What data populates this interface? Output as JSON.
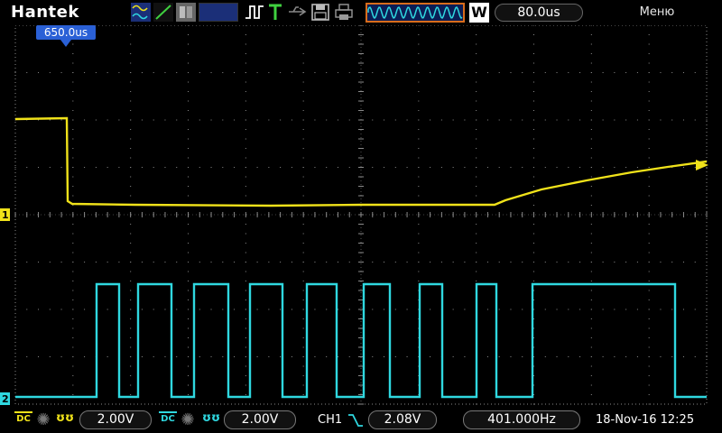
{
  "header": {
    "brand": "Hantek",
    "mode_w": "W",
    "timebase": "80.0us",
    "menu_label": "Меню"
  },
  "trigger_position": "650.0us",
  "channels": {
    "ch1": {
      "marker": "1",
      "color": "#f0e21a",
      "coupling": "DC",
      "volts_div": "2.00V"
    },
    "ch2": {
      "marker": "2",
      "color": "#2fd8e0",
      "coupling": "DC",
      "volts_div": "2.00V"
    }
  },
  "trigger": {
    "source": "CH1",
    "level": "2.08V"
  },
  "frequency": "401.000Hz",
  "datetime": "18-Nov-16 12:25",
  "colors": {
    "accent_orange": "#d86c1c",
    "marker_blue": "#2a60d6",
    "grid": "#8a8a8a"
  },
  "icons": [
    "waveform-icon",
    "run-stop-icon",
    "trigger-edge-icon",
    "trigger-t-icon",
    "usb-icon",
    "save-icon",
    "print-icon",
    "coupling-dc-icon",
    "bandwidth-icon",
    "falling-edge-icon"
  ]
}
